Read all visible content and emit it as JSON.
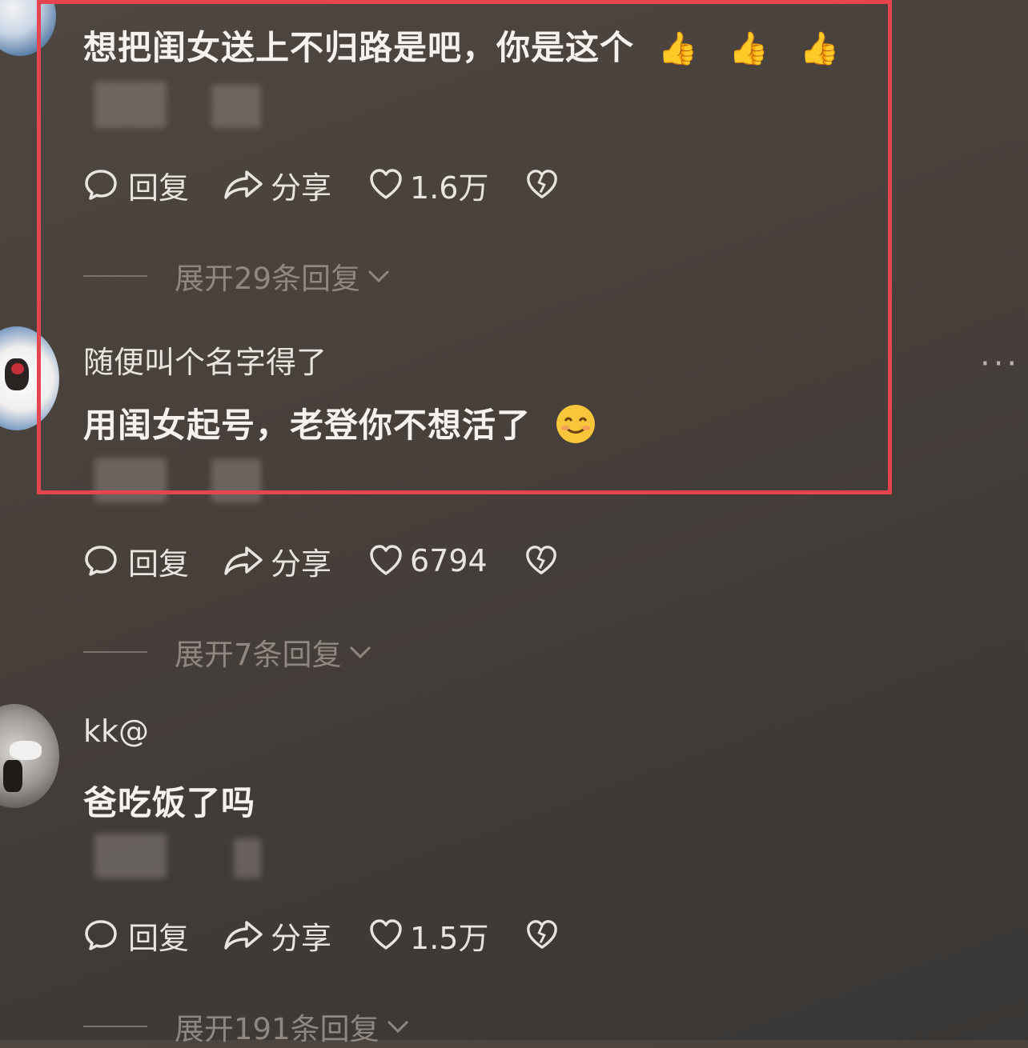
{
  "comments": [
    {
      "text": "想把闺女送上不归路是吧，你是这个",
      "emojis": [
        "thumbs-up",
        "thumbs-up",
        "thumbs-up"
      ],
      "reply_label": "回复",
      "share_label": "分享",
      "likes": "1.6万",
      "expand_label": "展开29条回复"
    },
    {
      "username": "随便叫个名字得了",
      "text": "用闺女起号，老登你不想活了",
      "emojis": [
        "smiling-face"
      ],
      "reply_label": "回复",
      "share_label": "分享",
      "likes": "6794",
      "expand_label": "展开7条回复"
    },
    {
      "username": "kk@",
      "text": "爸吃饭了吗",
      "reply_label": "回复",
      "share_label": "分享",
      "likes": "1.5万",
      "expand_label": "展开191条回复"
    }
  ],
  "more_menu": "···",
  "colors": {
    "highlight_border": "#e6454f",
    "background": "#48403b",
    "text": "#f4f1ee",
    "muted": "#8f8882"
  }
}
